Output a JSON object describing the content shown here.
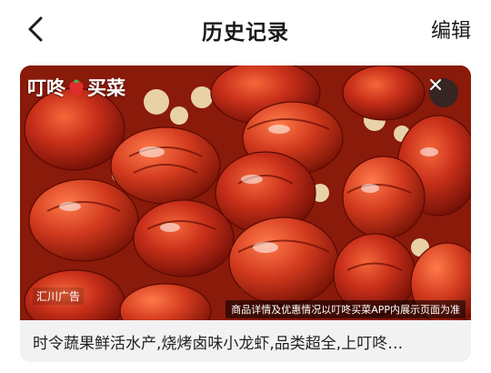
{
  "header": {
    "back_icon": "chevron-left-icon",
    "title": "历史记录",
    "edit_label": "编辑"
  },
  "ad": {
    "brand": {
      "part1": "叮咚",
      "part2": "买菜",
      "fruit_icon": "strawberry-icon"
    },
    "close_icon": "close-icon",
    "tag": "汇川广告",
    "disclaimer": "商品详情及优惠情况以叮咚买菜APP内展示页面为准",
    "caption": "时令蔬果鲜活水产,烧烤卤味小龙虾,品类超全,上叮咚…",
    "image_subject": "crayfish-photo"
  },
  "colors": {
    "text_primary": "#1a1a1a",
    "caption_bg": "#f2f2f2",
    "brand_red": "#e02c2c",
    "close_bg": "#2a2a2a",
    "crayfish": "#c0280f"
  }
}
